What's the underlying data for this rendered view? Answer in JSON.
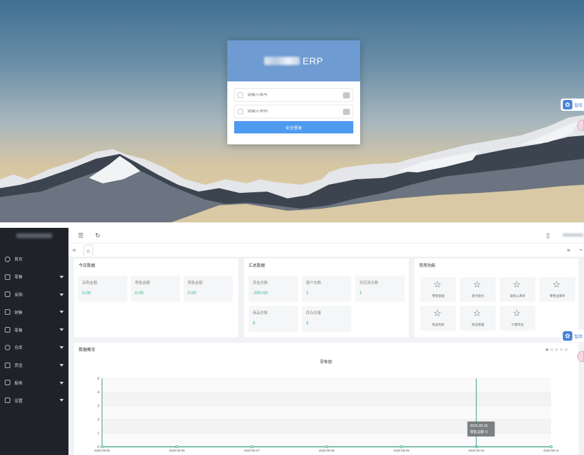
{
  "login": {
    "brand_suffix": "ERP",
    "username_placeholder": "请输入账号",
    "password_placeholder": "请输入密码",
    "submit_label": "安全登录",
    "float_tab_label": "智库"
  },
  "sidebar": {
    "items": [
      {
        "label": "首页",
        "icon": "home-icon",
        "expandable": false
      },
      {
        "label": "零售",
        "icon": "cart-icon",
        "expandable": true
      },
      {
        "label": "采购",
        "icon": "cart-icon",
        "expandable": true
      },
      {
        "label": "销售",
        "icon": "cart-icon",
        "expandable": true
      },
      {
        "label": "零售",
        "icon": "retail-icon",
        "expandable": true
      },
      {
        "label": "仓库",
        "icon": "warehouse-icon",
        "expandable": true
      },
      {
        "label": "资金",
        "icon": "money-icon",
        "expandable": true
      },
      {
        "label": "报表",
        "icon": "report-icon",
        "expandable": true
      },
      {
        "label": "设置",
        "icon": "settings-icon",
        "expandable": true
      }
    ]
  },
  "today": {
    "title": "今日数据",
    "stats": [
      {
        "label": "采购金额",
        "value": "0.00"
      },
      {
        "label": "零售金额",
        "value": "0.00"
      },
      {
        "label": "销售金额",
        "value": "0.00"
      }
    ]
  },
  "summary": {
    "title": "汇总数据",
    "stats": [
      {
        "label": "资金总数",
        "value": "-300.00"
      },
      {
        "label": "客户总数",
        "value": "1"
      },
      {
        "label": "供应商总数",
        "value": "1"
      },
      {
        "label": "商品总数",
        "value": "3"
      },
      {
        "label": "库存总量",
        "value": "3"
      }
    ]
  },
  "functions": {
    "title": "常用功能",
    "items": [
      "零售管理",
      "盘点盘点",
      "采购入库单",
      "零售出库单",
      "商品列表",
      "商品管理",
      "计量单位"
    ]
  },
  "overview": {
    "title": "数据概览",
    "chart_title": "零售额"
  },
  "chart_data": {
    "type": "line",
    "title": "零售额",
    "x": [
      "2025-09-05",
      "2025-09-06",
      "2025-09-07",
      "2025-09-08",
      "2025-09-09",
      "2025-09-10",
      "2025-09-11"
    ],
    "values": [
      0,
      0,
      0,
      0,
      0,
      0,
      0
    ],
    "ylim": [
      0,
      5
    ],
    "yticks": [
      "0",
      "1",
      "2",
      "3",
      "4",
      "5"
    ],
    "grid": true,
    "color": "#2f9e84",
    "tooltip": {
      "date": "2025-09-10",
      "text": "零售总额: 0"
    }
  },
  "colors": {
    "accent": "#4d9aef",
    "sidebar": "#1f2329",
    "value_green": "#2bb58a"
  }
}
